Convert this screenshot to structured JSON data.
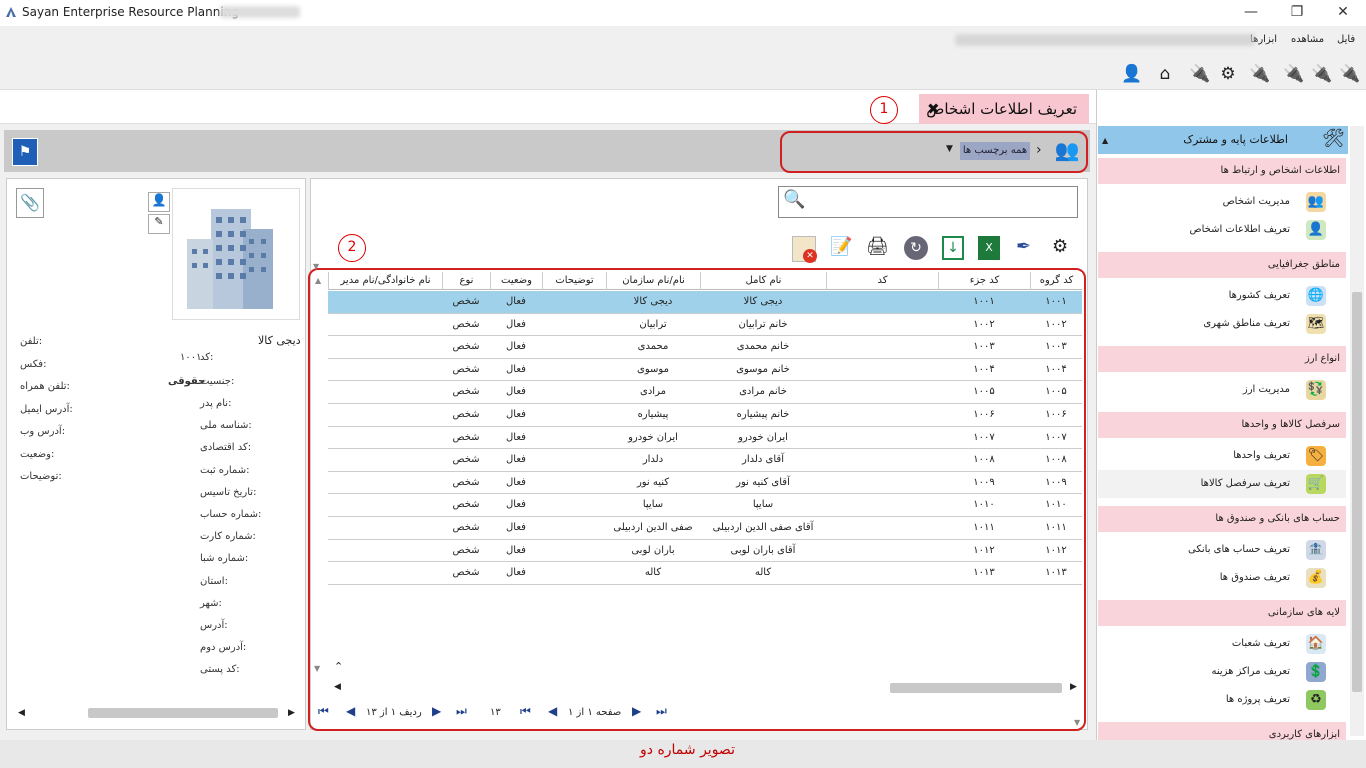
{
  "window": {
    "title": "Sayan Enterprise Resource Planning -",
    "minimize": "—",
    "maximize": "❐",
    "close": "✕"
  },
  "menu": {
    "file": "فایل",
    "view": "مشاهده",
    "tools": "ابزارها"
  },
  "tab": {
    "title": "تعریف اطلاعات اشخاص",
    "close": "✖"
  },
  "annotations": {
    "one": "1",
    "two": "2"
  },
  "breadcrumb": {
    "tag": "همه برچسب ها",
    "sep": "›"
  },
  "sidebar": {
    "header": "اطلاعات پایه و مشترک",
    "sections": [
      {
        "title": "اطلاعات اشخاص و ارتباط ها",
        "items": [
          "مدیریت اشخاص",
          "تعریف اطلاعات اشخاص"
        ]
      },
      {
        "title": "مناطق جغرافیایی",
        "items": [
          "تعریف کشورها",
          "تعریف مناطق شهری"
        ]
      },
      {
        "title": "انواع ارز",
        "items": [
          "مدیریت ارز"
        ]
      },
      {
        "title": "سرفصل کالاها و واحدها",
        "items": [
          "تعریف واحدها",
          "تعریف سرفصل کالاها"
        ]
      },
      {
        "title": "حساب های بانکی و صندوق ها",
        "items": [
          "تعریف حساب های بانکی",
          "تعریف صندوق ها"
        ]
      },
      {
        "title": "لایه های سازمانی",
        "items": [
          "تعریف شعبات",
          "تعریف مراکز هزینه",
          "تعریف پروژه ها"
        ]
      },
      {
        "title": "ابزارهای کاربردی",
        "items": []
      }
    ]
  },
  "grid": {
    "headers": [
      "کد گروه",
      "کد جزء",
      "کد",
      "نام کامل",
      "نام/نام سازمان",
      "توضیحات",
      "وضعیت",
      "نوع",
      "نام خانوادگی/نام مدیر"
    ],
    "rows": [
      [
        "۱۰۰۱",
        "۱۰۰۱",
        "دیجی کالا",
        "دیجی کالا",
        "فعال",
        "شخص"
      ],
      [
        "۱۰۰۲",
        "۱۰۰۲",
        "خانم ترابیان",
        "ترابیان",
        "فعال",
        "شخص"
      ],
      [
        "۱۰۰۳",
        "۱۰۰۳",
        "خانم محمدی",
        "محمدی",
        "فعال",
        "شخص"
      ],
      [
        "۱۰۰۴",
        "۱۰۰۴",
        "خانم موسوی",
        "موسوی",
        "فعال",
        "شخص"
      ],
      [
        "۱۰۰۵",
        "۱۰۰۵",
        "خانم مرادی",
        "مرادی",
        "فعال",
        "شخص"
      ],
      [
        "۱۰۰۶",
        "۱۰۰۶",
        "خانم پیشیاره",
        "پیشیاره",
        "فعال",
        "شخص"
      ],
      [
        "۱۰۰۷",
        "۱۰۰۷",
        "ایران خودرو",
        "ایران خودرو",
        "فعال",
        "شخص"
      ],
      [
        "۱۰۰۸",
        "۱۰۰۸",
        "آقای دلدار",
        "دلدار",
        "فعال",
        "شخص"
      ],
      [
        "۱۰۰۹",
        "۱۰۰۹",
        "آقای کنیه نور",
        "کنیه نور",
        "فعال",
        "شخص"
      ],
      [
        "۱۰۱۰",
        "۱۰۱۰",
        "سایپا",
        "سایپا",
        "فعال",
        "شخص"
      ],
      [
        "۱۰۱۱",
        "۱۰۱۱",
        "آقای صفی الدین اردبیلی",
        "صفی الدین اردبیلی",
        "فعال",
        "شخص"
      ],
      [
        "۱۰۱۲",
        "۱۰۱۲",
        "آقای باران لوبی",
        "باران لوبی",
        "فعال",
        "شخص"
      ],
      [
        "۱۰۱۳",
        "۱۰۱۳",
        "کاله",
        "کاله",
        "فعال",
        "شخص"
      ]
    ]
  },
  "pager": {
    "page": "صفحه ۱ از ۱",
    "count": "۱۳",
    "rows": "ردیف ۱ از ۱۳"
  },
  "detail": {
    "name": "دیجی کالا",
    "code_label": "کد:",
    "code_value": "۱۰۰۱",
    "gender_label": "جنسیت:",
    "gender_value": "حقوقی",
    "left_labels": [
      "نام پدر:",
      "شناسه ملی:",
      "کد اقتصادی:",
      "شماره ثبت:",
      "تاریخ تاسیس:",
      "شماره حساب:",
      "شماره کارت:",
      "شماره شبا:",
      "استان:",
      "شهر:",
      "آدرس:",
      "آدرس دوم:",
      "کد پستی:"
    ],
    "right_labels": [
      "تلفن:",
      "فکس:",
      "تلفن همراه:",
      "آدرس ایمیل:",
      "آدرس وب:",
      "وضعیت:",
      "توضیحات:"
    ]
  },
  "status": {
    "caption": "تصویر شماره دو"
  }
}
